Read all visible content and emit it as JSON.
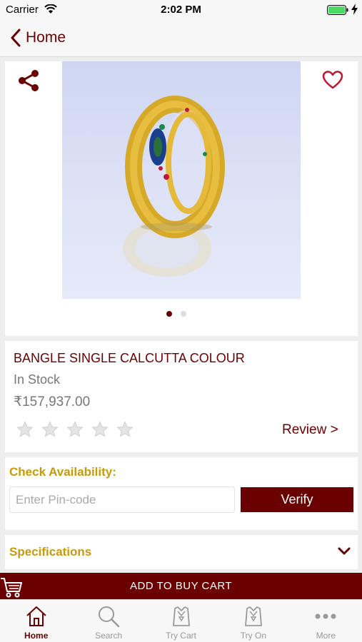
{
  "status_bar": {
    "carrier": "Carrier",
    "time": "2:02 PM"
  },
  "nav": {
    "back_label": "Home"
  },
  "product": {
    "name": "BANGLE SINGLE CALCUTTA COLOUR",
    "stock": "In Stock",
    "price": "₹157,937.00",
    "rating_stars": 5,
    "rating_filled": 0,
    "review_label": "Review >",
    "image_pages": 2,
    "active_page": 1
  },
  "availability": {
    "title": "Check Availability:",
    "pin_placeholder": "Enter Pin-code",
    "pin_value": "",
    "verify_label": "Verify"
  },
  "specifications": {
    "title": "Specifications"
  },
  "cart_bar": {
    "label": "ADD TO BUY CART"
  },
  "tabs": [
    {
      "label": "Home",
      "icon": "home-icon",
      "active": true
    },
    {
      "label": "Search",
      "icon": "search-icon",
      "active": false
    },
    {
      "label": "Try Cart",
      "icon": "try-cart-icon",
      "active": false
    },
    {
      "label": "Try On",
      "icon": "try-on-icon",
      "active": false
    },
    {
      "label": "More",
      "icon": "more-icon",
      "active": false
    }
  ],
  "colors": {
    "brand": "#6b0000",
    "accent": "#c89a0a",
    "battery": "#4cd964"
  }
}
